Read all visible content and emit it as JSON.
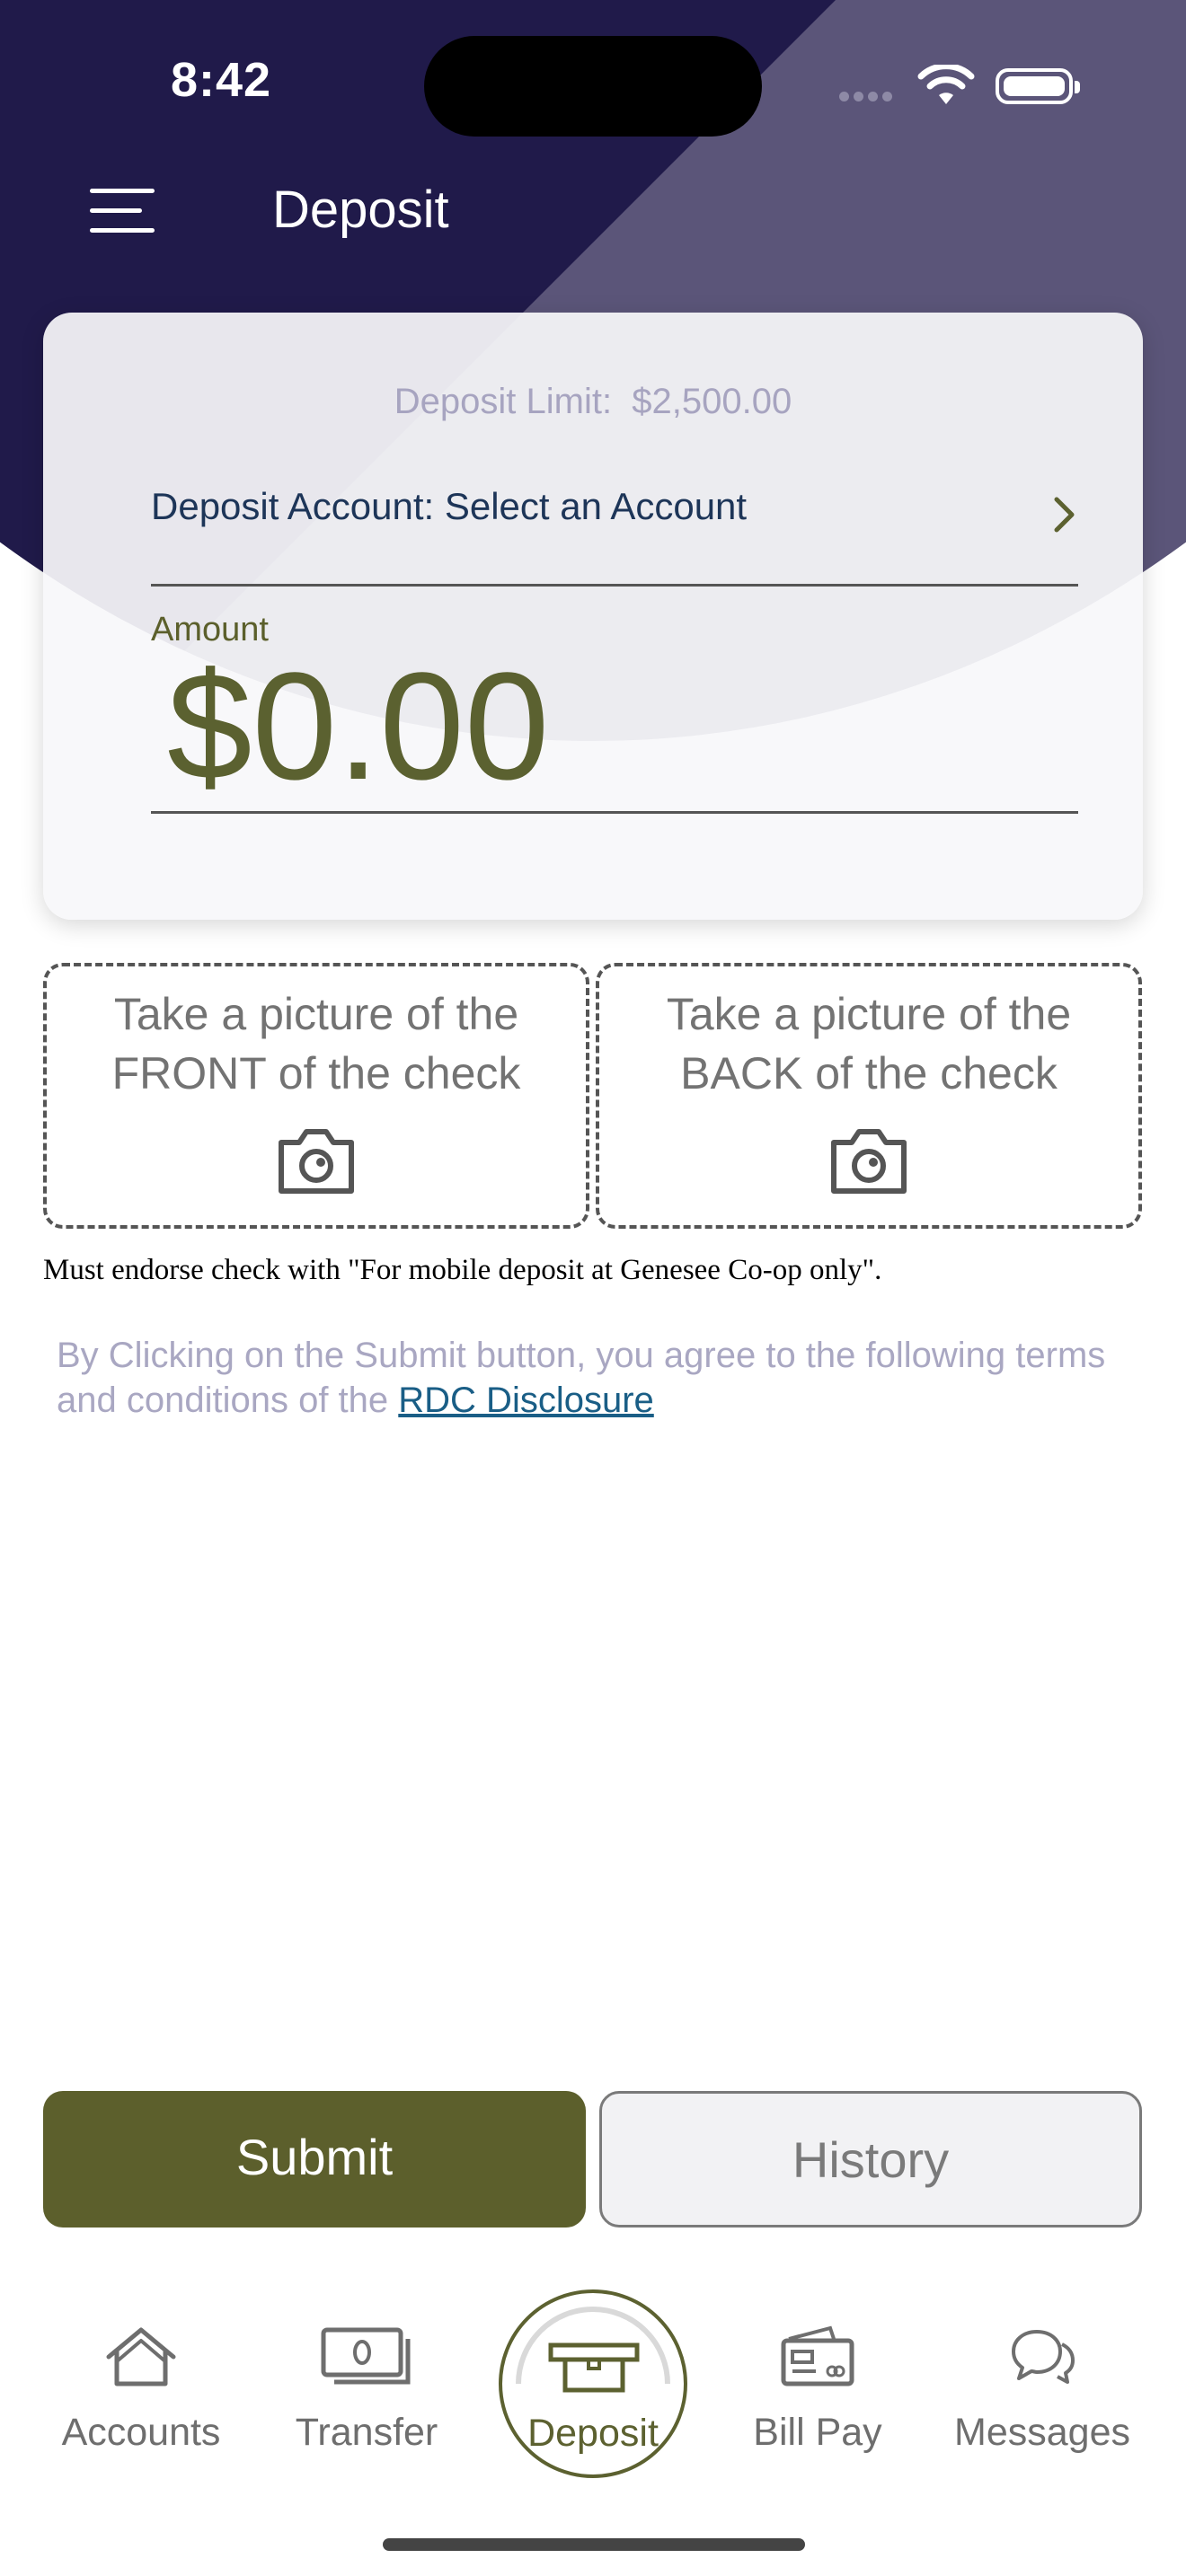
{
  "status_bar": {
    "time": "8:42"
  },
  "header": {
    "title": "Deposit"
  },
  "card": {
    "limit_label": "Deposit Limit:",
    "limit_value": "$2,500.00",
    "account_label": "Deposit Account: Select an Account",
    "amount_label": "Amount",
    "amount_value": "$0.00"
  },
  "photos": {
    "front_text_1": "Take a picture of the",
    "front_text_2": "FRONT of the check",
    "back_text_1": "Take a picture of the",
    "back_text_2": "BACK of the check"
  },
  "endorse_note": "Must endorse check with \"For mobile deposit at Genesee Co-op only\".",
  "terms": {
    "text": "By Clicking on the Submit button, you agree to the following terms and conditions of the ",
    "link": "RDC Disclosure"
  },
  "buttons": {
    "submit": "Submit",
    "history": "History"
  },
  "tabs": [
    {
      "label": "Accounts",
      "icon": "home-icon"
    },
    {
      "label": "Transfer",
      "icon": "cash-icon"
    },
    {
      "label": "Deposit",
      "icon": "atm-icon",
      "active": true
    },
    {
      "label": "Bill Pay",
      "icon": "bill-pay-icon"
    },
    {
      "label": "Messages",
      "icon": "chat-icon"
    }
  ],
  "colors": {
    "header_dark": "#201a4a",
    "header_light": "#5b5579",
    "accent_olive": "#5c5f2c",
    "link": "#1a5e86"
  }
}
